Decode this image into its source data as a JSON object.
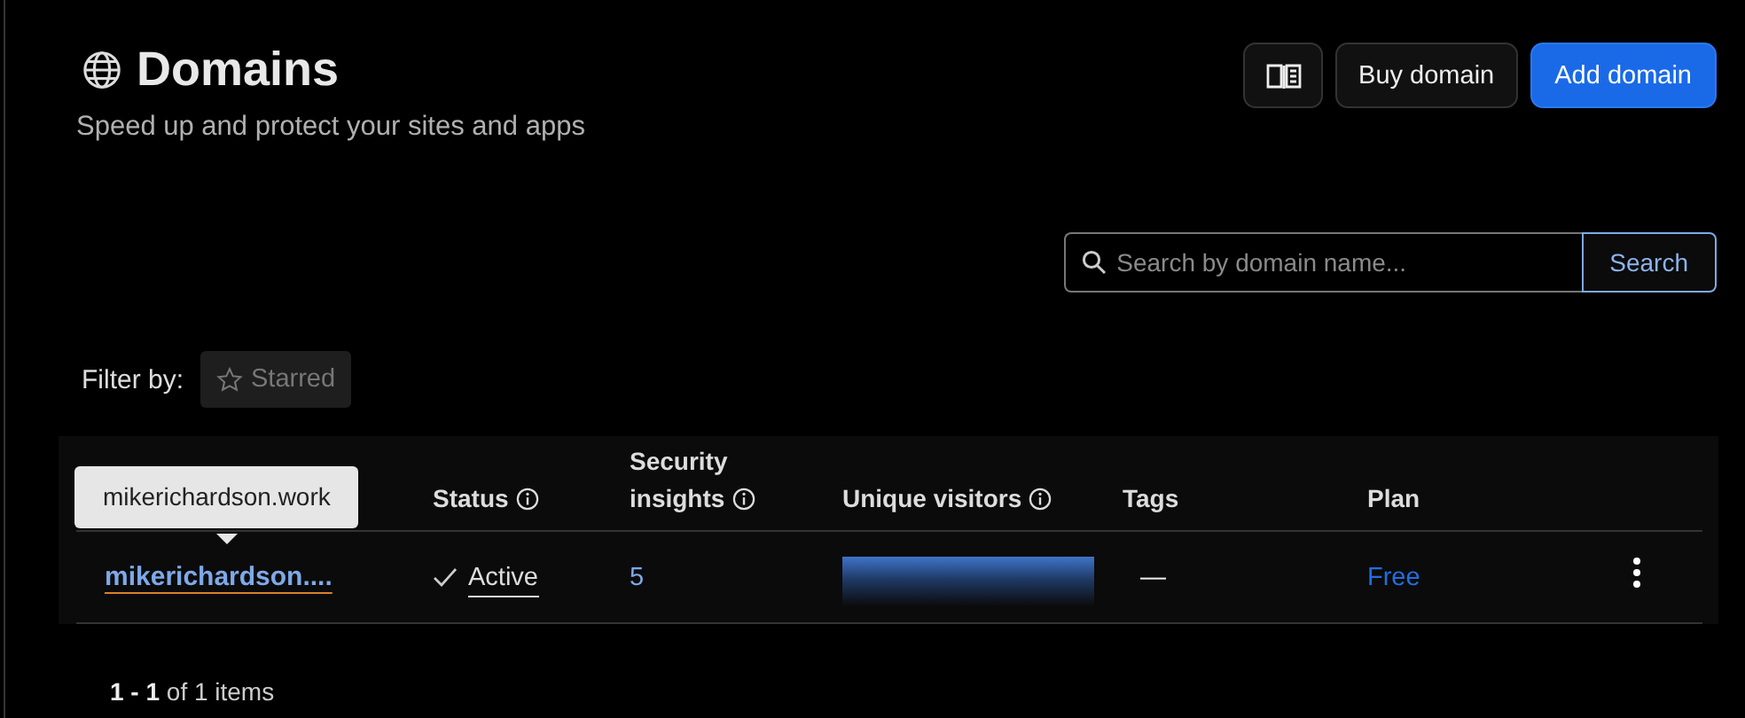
{
  "header": {
    "title": "Domains",
    "subtitle": "Speed up and protect your sites and apps"
  },
  "actions": [
    {
      "kind": "icon"
    },
    {
      "kind": "secondary",
      "label": "Buy domain"
    },
    {
      "kind": "primary",
      "label": "Add domain"
    }
  ],
  "search": {
    "placeholder": "Search by domain name...",
    "button": "Search"
  },
  "filter": {
    "label": "Filter by:",
    "chips": [
      {
        "label": "Starred",
        "selected": false
      }
    ]
  },
  "table": {
    "columns": [
      {
        "label": "Status",
        "info": true
      },
      {
        "label": "Security insights",
        "info": true
      },
      {
        "label": "Unique visitors",
        "info": true
      },
      {
        "label": "Tags",
        "info": false
      },
      {
        "label": "Plan",
        "info": false
      }
    ],
    "rows": [
      {
        "domain": "mikerichardson....",
        "status": "Active",
        "security_insights": "5",
        "tags": "—",
        "plan": "Free"
      }
    ]
  },
  "tooltip": {
    "text": "mikerichardson.work"
  },
  "pagination": {
    "summary": "**1 - 1** of 1 items"
  }
}
